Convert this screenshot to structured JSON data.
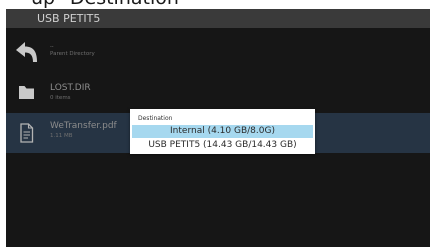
{
  "caption": "up \"Destination\"",
  "titlebar": {
    "title": "USB PETIT5"
  },
  "rows": [
    {
      "icon": "back-arrow-icon",
      "name": "..",
      "meta": "Parent Directory"
    },
    {
      "icon": "folder-icon",
      "name": "LOST.DIR",
      "meta": "0 items"
    },
    {
      "icon": "document-icon",
      "name": "WeTransfer.pdf",
      "meta": "1.11 MB",
      "selected": true
    }
  ],
  "dialog": {
    "title": "Destination",
    "options": [
      {
        "label": "Internal (4.10 GB/8.0G)",
        "selected": true
      },
      {
        "label": "USB PETIT5 (14.43 GB/14.43 GB)",
        "selected": false
      }
    ]
  },
  "colors": {
    "background": "#161616",
    "titlebar": "#3a3a3a",
    "selected_row": "#263444",
    "selected_option": "#a6d8ef",
    "icon": "#c9c9c9"
  }
}
